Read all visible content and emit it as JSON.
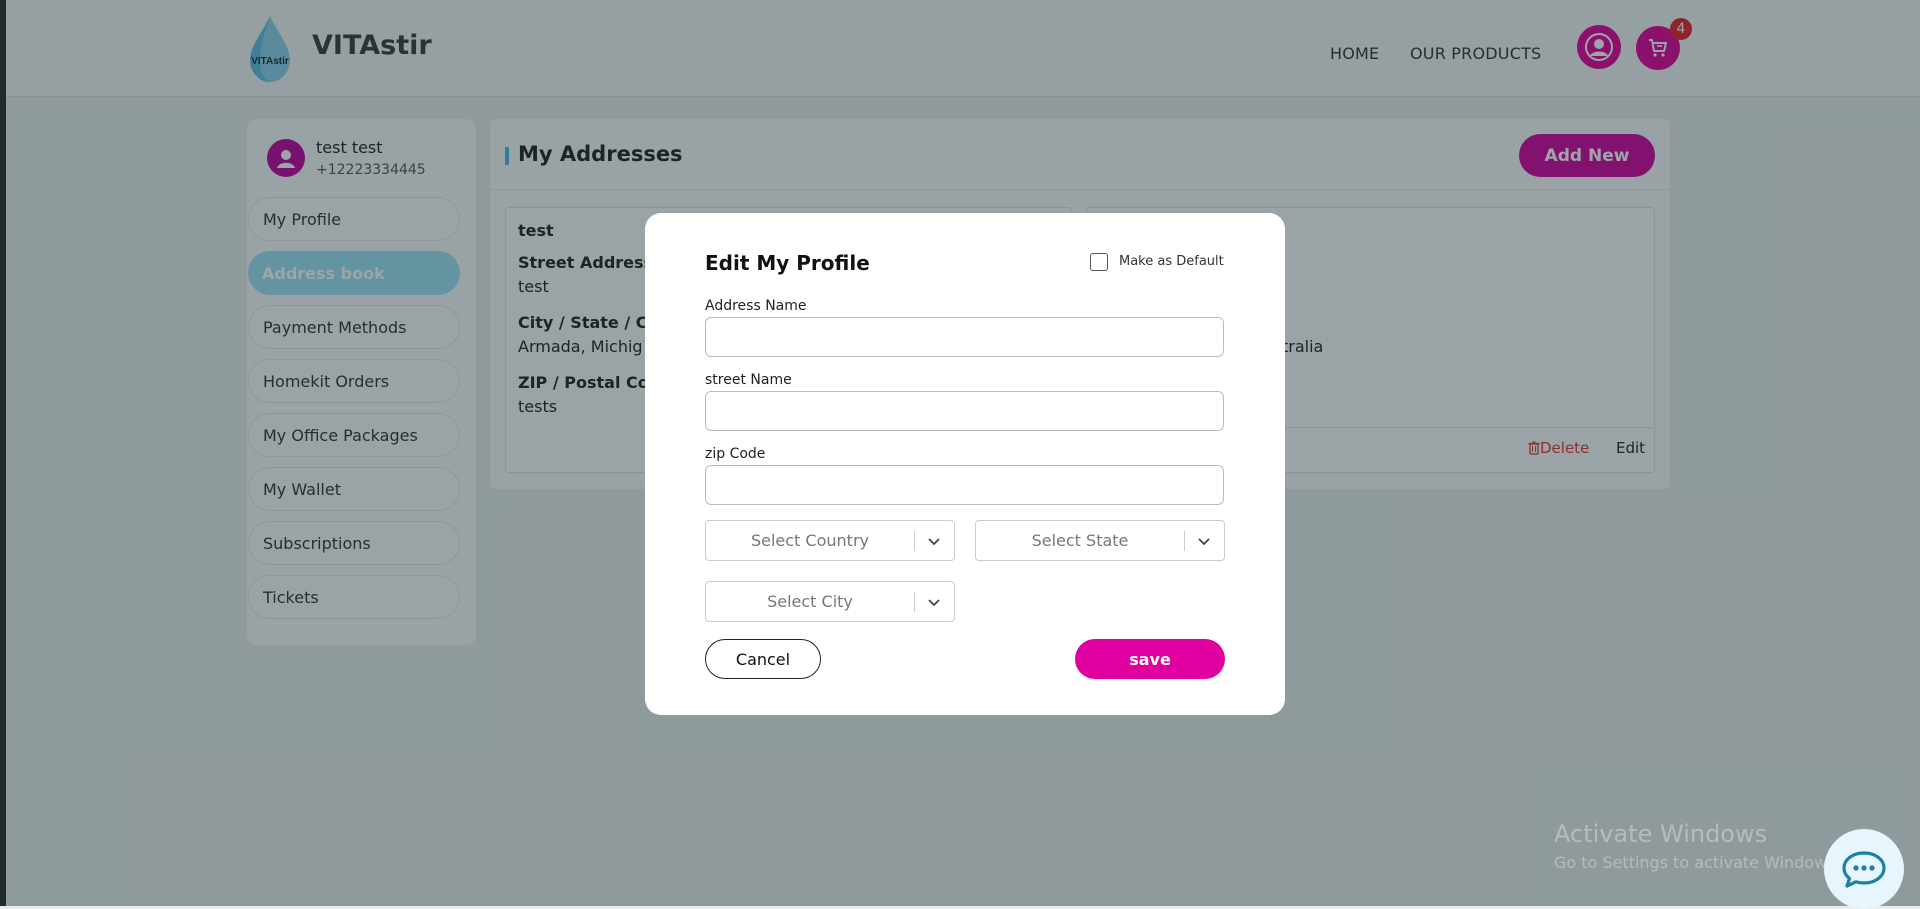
{
  "header": {
    "brand": "VITAstir",
    "logo_text": "VITAstir",
    "nav_home": "HOME",
    "nav_products": "OUR PRODUCTS",
    "cart_count": "4",
    "accent_color": "#e3009a"
  },
  "profile": {
    "name": "test test",
    "phone": "+12223334445"
  },
  "sidebar": {
    "items": [
      {
        "label": "My Profile"
      },
      {
        "label": "Address book"
      },
      {
        "label": "Payment Methods"
      },
      {
        "label": "Homekit Orders"
      },
      {
        "label": "My Office Packages"
      },
      {
        "label": "My Wallet"
      },
      {
        "label": "Subscriptions"
      },
      {
        "label": "Tickets"
      }
    ],
    "active_index": 1
  },
  "addresses": {
    "title": "My Addresses",
    "add_new": "Add New",
    "cards": [
      {
        "name": "test",
        "street_label": "Street Address",
        "street_value": "test",
        "city_label": "City / State / Co",
        "city_value": "Armada, Michig",
        "zip_label": "ZIP / Postal Cod",
        "zip_value": "tests"
      },
      {
        "city_value": "tralia",
        "delete_label": "Delete",
        "edit_label": "Edit"
      }
    ]
  },
  "modal": {
    "title": "Edit My Profile",
    "default_label": "Make as Default",
    "address_name_label": "Address Name",
    "street_name_label": "street Name",
    "zip_label": "zip Code",
    "address_name_value": "",
    "street_name_value": "",
    "zip_value": "",
    "country_placeholder": "Select Country",
    "state_placeholder": "Select State",
    "city_placeholder": "Select City",
    "cancel_label": "Cancel",
    "save_label": "save"
  },
  "watermark": {
    "line1": "Activate Windows",
    "line2": "Go to Settings to activate Windows."
  }
}
